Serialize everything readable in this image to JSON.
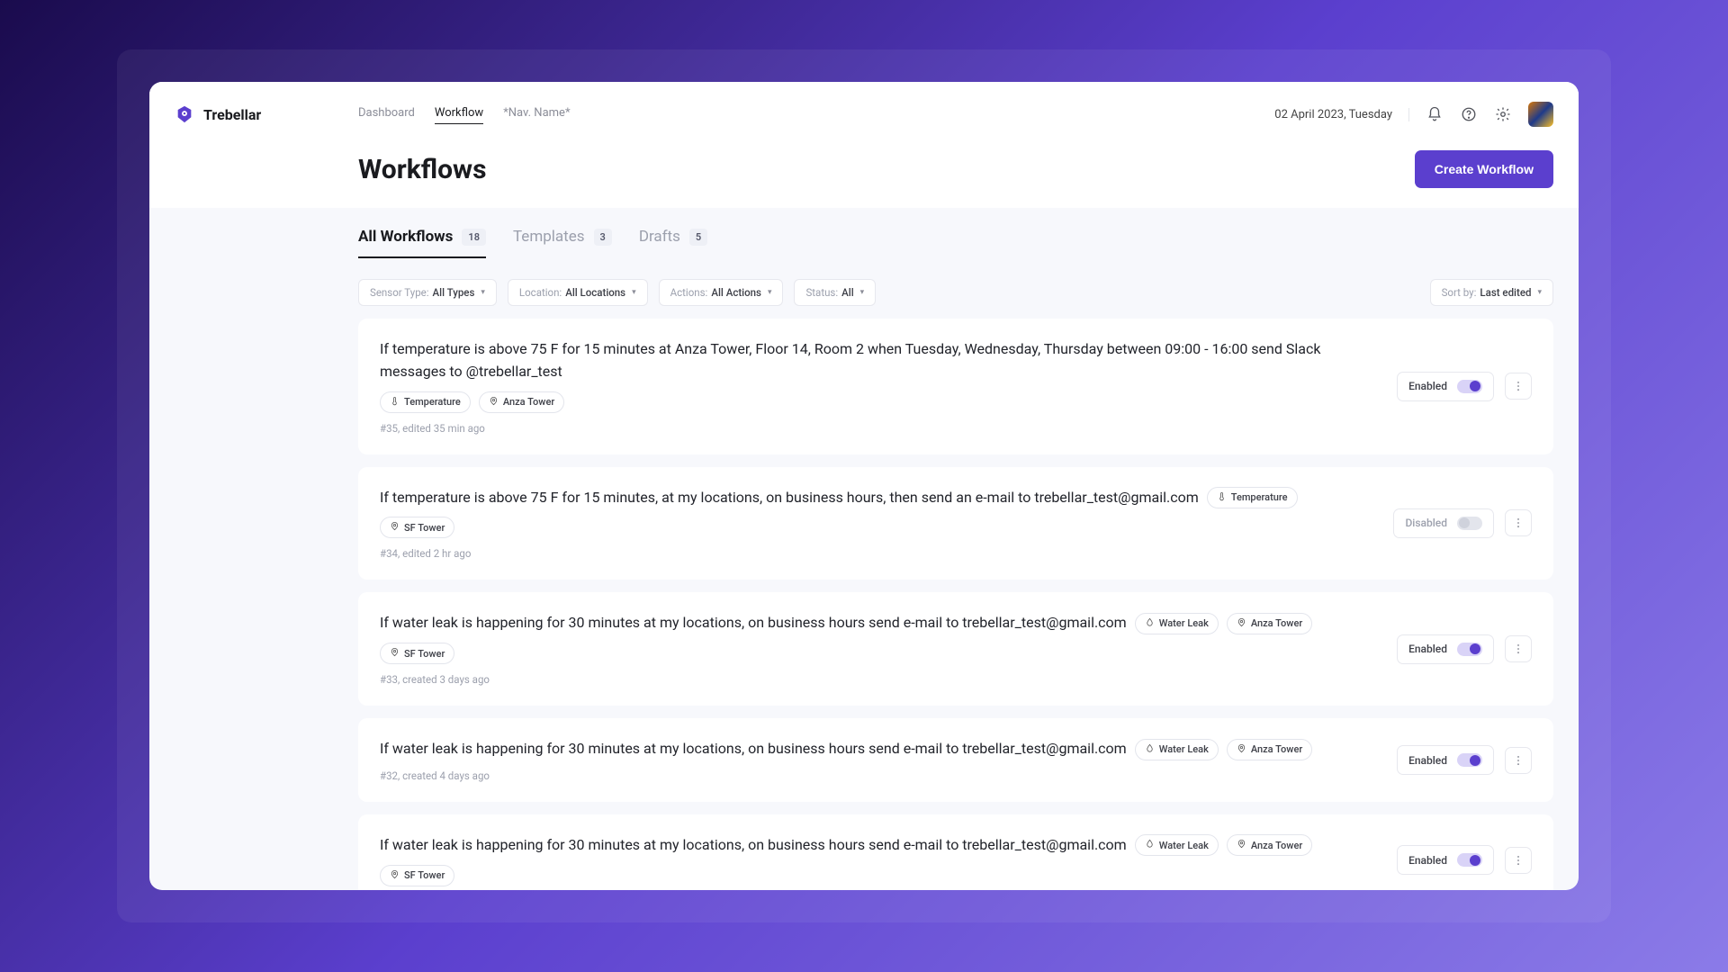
{
  "brand": {
    "name": "Trebellar"
  },
  "nav": {
    "items": [
      {
        "label": "Dashboard",
        "active": false
      },
      {
        "label": "Workflow",
        "active": true
      },
      {
        "label": "*Nav. Name*",
        "active": false
      }
    ]
  },
  "header": {
    "date": "02 April 2023, Tuesday",
    "title": "Workflows",
    "create_button": "Create Workflow"
  },
  "tabs": [
    {
      "label": "All Workflows",
      "count": "18",
      "active": true
    },
    {
      "label": "Templates",
      "count": "3",
      "active": false
    },
    {
      "label": "Drafts",
      "count": "5",
      "active": false
    }
  ],
  "filters": {
    "sensor": {
      "label": "Sensor Type:",
      "value": "All Types"
    },
    "location": {
      "label": "Location:",
      "value": "All Locations"
    },
    "actions": {
      "label": "Actions:",
      "value": "All Actions"
    },
    "status": {
      "label": "Status:",
      "value": "All"
    },
    "sort": {
      "label": "Sort by:",
      "value": "Last edited"
    }
  },
  "workflows": [
    {
      "description": "If temperature is above 75 F for 15 minutes at Anza Tower, Floor 14, Room 2 when Tuesday, Wednesday, Thursday between 09:00 - 16:00 send Slack messages to @trebellar_test",
      "tags": [
        {
          "icon": "temperature",
          "label": "Temperature"
        },
        {
          "icon": "location",
          "label": "Anza Tower"
        }
      ],
      "meta": "#35, edited 35 min ago",
      "enabled": true,
      "state_label": "Enabled"
    },
    {
      "description": "If temperature is above 75 F for 15 minutes, at my locations, on business hours, then send an e-mail to trebellar_test@gmail.com",
      "tags": [
        {
          "icon": "temperature",
          "label": "Temperature"
        },
        {
          "icon": "location",
          "label": "SF Tower"
        }
      ],
      "meta": "#34, edited 2 hr ago",
      "enabled": false,
      "state_label": "Disabled"
    },
    {
      "description": "If water leak is happening for 30 minutes at my locations, on business hours send e-mail to trebellar_test@gmail.com",
      "tags": [
        {
          "icon": "water",
          "label": "Water Leak"
        },
        {
          "icon": "location",
          "label": "Anza Tower"
        },
        {
          "icon": "location",
          "label": "SF Tower"
        }
      ],
      "meta": "#33, created 3 days ago",
      "enabled": true,
      "state_label": "Enabled"
    },
    {
      "description": "If water leak is happening for 30 minutes at my locations, on business hours send e-mail to trebellar_test@gmail.com",
      "tags": [
        {
          "icon": "water",
          "label": "Water Leak"
        },
        {
          "icon": "location",
          "label": "Anza Tower"
        }
      ],
      "meta": "#32, created 4 days ago",
      "enabled": true,
      "state_label": "Enabled"
    },
    {
      "description": "If water leak is happening for 30 minutes at my locations, on business hours send e-mail to trebellar_test@gmail.com",
      "tags": [
        {
          "icon": "water",
          "label": "Water Leak"
        },
        {
          "icon": "location",
          "label": "Anza Tower"
        },
        {
          "icon": "location",
          "label": "SF Tower"
        }
      ],
      "meta": "",
      "enabled": true,
      "state_label": "Enabled"
    }
  ],
  "colors": {
    "accent": "#5b3fce"
  }
}
